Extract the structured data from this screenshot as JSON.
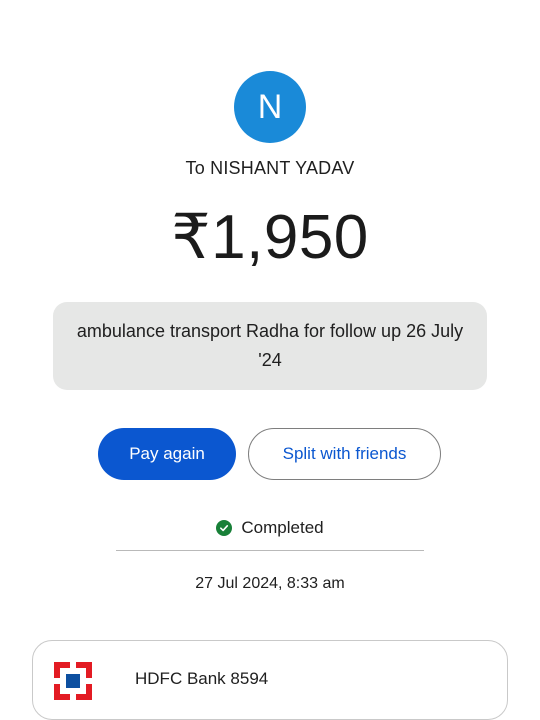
{
  "recipient": {
    "initial": "N",
    "label": "To NISHANT YADAV",
    "avatar_color": "#1a8ad8"
  },
  "transaction": {
    "amount": "₹1,950",
    "note": "ambulance transport Radha for follow up 26 July '24",
    "status": "Completed",
    "status_color": "#188038",
    "datetime": "27 Jul 2024, 8:33 am"
  },
  "actions": {
    "pay_again": "Pay again",
    "split": "Split with friends",
    "primary_color": "#0b57d0"
  },
  "bank": {
    "label": "HDFC Bank 8594",
    "logo_icon": "hdfc-bank-logo-icon",
    "logo_color": "#e31b23"
  }
}
